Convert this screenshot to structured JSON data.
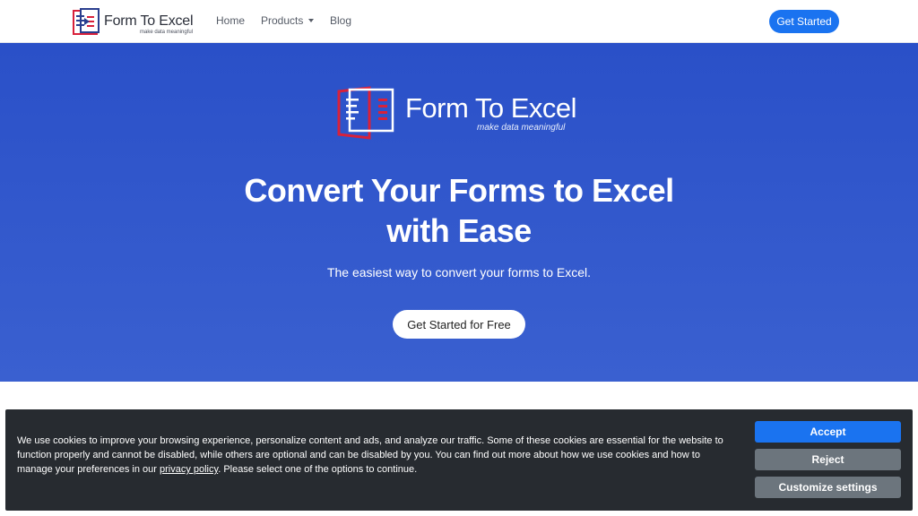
{
  "navbar": {
    "brand_name": "Form To Excel",
    "brand_tagline": "make data meaningful",
    "links": {
      "home": "Home",
      "products": "Products",
      "blog": "Blog"
    },
    "cta": "Get Started"
  },
  "hero": {
    "logo_name": "Form To Excel",
    "logo_tagline": "make data meaningful",
    "title_line1": "Convert Your Forms to Excel",
    "title_line2": "with Ease",
    "subtitle": "The easiest way to convert your forms to Excel.",
    "cta": "Get Started for Free"
  },
  "cookie_banner": {
    "text_before_link": "We use cookies to improve your browsing experience, personalize content and ads, and analyze our traffic. Some of these cookies are essential for the website to function properly and cannot be disabled, while others are optional and can be disabled by you. You can find out more about how we use cookies and how to manage your preferences in our ",
    "link_text": "privacy policy",
    "text_after_link": ". Please select one of the options to continue.",
    "accept": "Accept",
    "reject": "Reject",
    "customize": "Customize settings"
  },
  "colors": {
    "accent": "#1a73f0",
    "hero_bg": "#2f55cc",
    "banner_bg": "#272b30",
    "secondary_button": "#6c757d",
    "logo_red": "#d8213a"
  }
}
